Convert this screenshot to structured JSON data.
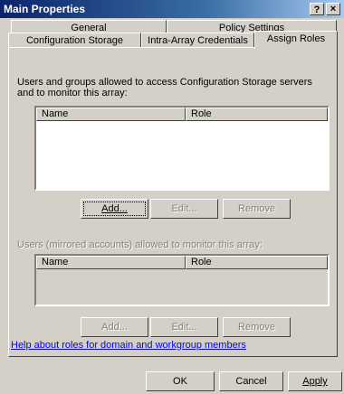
{
  "window": {
    "title": "Main Properties",
    "help_label": "?",
    "close_label": "×"
  },
  "tabs": {
    "general": "General",
    "policy_settings": "Policy Settings",
    "configuration_storage": "Configuration Storage",
    "intra_array_credentials": "Intra-Array Credentials",
    "assign_roles": "Assign Roles"
  },
  "section1": {
    "description": "Users and groups allowed to access Configuration Storage servers and to monitor this array:",
    "col_name": "Name",
    "col_role": "Role",
    "add_label": "Add...",
    "edit_label": "Edit...",
    "remove_label": "Remove"
  },
  "section2": {
    "description": "Users (mirrored accounts) allowed to monitor this array:",
    "col_name": "Name",
    "col_role": "Role",
    "add_label": "Add...",
    "edit_label": "Edit...",
    "remove_label": "Remove"
  },
  "help_link": "Help about roles for domain and workgroup members",
  "footer": {
    "ok_label": "OK",
    "cancel_label": "Cancel",
    "apply_label": "Apply"
  }
}
